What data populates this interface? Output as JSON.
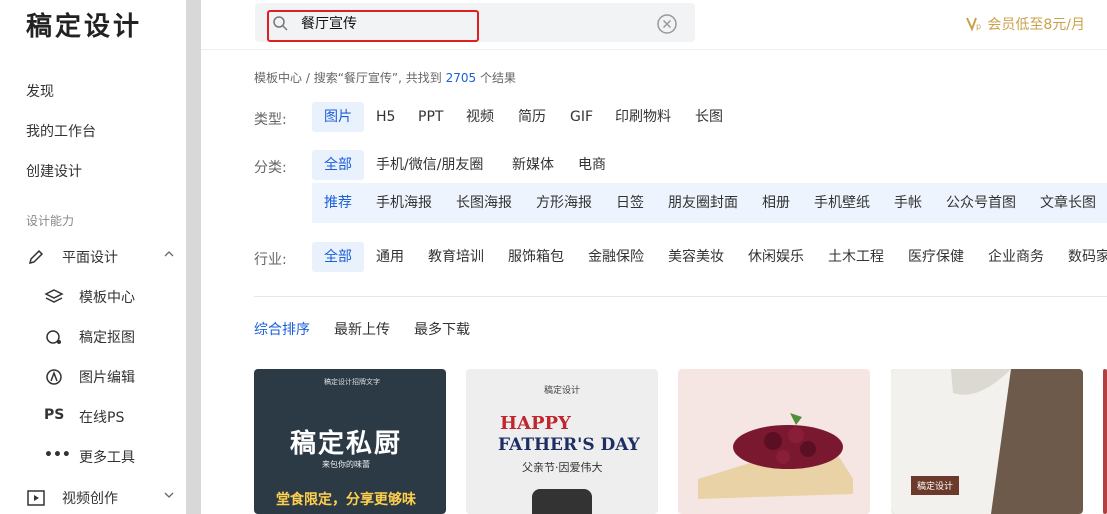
{
  "sidebar": {
    "logo": "稿定设计",
    "links": [
      "发现",
      "我的工作台",
      "创建设计"
    ],
    "section_title": "设计能力",
    "group1": "平面设计",
    "sub_items": [
      {
        "label": "模板中心",
        "icon": "layers-icon"
      },
      {
        "label": "稿定抠图",
        "icon": "cutout-icon"
      },
      {
        "label": "图片编辑",
        "icon": "image-edit-icon"
      },
      {
        "label": "在线PS",
        "icon": "ps-icon",
        "glyph": "PS"
      },
      {
        "label": "更多工具",
        "icon": "more-icon",
        "glyph": "•••"
      }
    ],
    "group2": "视频创作"
  },
  "search": {
    "value": "餐厅宣传",
    "placeholder": ""
  },
  "vip": {
    "text": "会员低至8元/月"
  },
  "breadcrumb": {
    "root": "模板中心",
    "sep": "/",
    "prefix": "搜索“餐厅宣传”, 共找到",
    "count": "2705",
    "suffix": "个结果"
  },
  "filters": {
    "type_label": "类型:",
    "types": [
      "图片",
      "H5",
      "PPT",
      "视频",
      "简历",
      "GIF",
      "印刷物料",
      "长图"
    ],
    "category_label": "分类:",
    "categories": [
      "全部",
      "手机/微信/朋友圈",
      "新媒体",
      "电商"
    ],
    "subcategories": [
      "推荐",
      "手机海报",
      "长图海报",
      "方形海报",
      "日签",
      "朋友圈封面",
      "相册",
      "手机壁纸",
      "手帐",
      "公众号首图",
      "文章长图"
    ],
    "industry_label": "行业:",
    "industries": [
      "全部",
      "通用",
      "教育培训",
      "服饰箱包",
      "金融保险",
      "美容美妆",
      "休闲娱乐",
      "土木工程",
      "医疗保健",
      "企业商务",
      "数码家"
    ]
  },
  "sort": [
    "综合排序",
    "最新上传",
    "最多下载"
  ],
  "cards": {
    "c1": {
      "small": "稿定设计招牌文字",
      "big": "稿定私厨",
      "sub": "来包你的味蕾",
      "foot": "堂食限定，分享更够味"
    },
    "c2": {
      "small": "稿定设计",
      "head": "HAPPY",
      "head2": "FATHER'S DAY",
      "sub": "父亲节·因爱伟大"
    },
    "c4": {
      "tag": "稿定设计"
    }
  },
  "colors": {
    "accent": "#1a5fd9",
    "chip_bg": "#e9f1fd",
    "vip": "#c9a24a",
    "highlight": "#e02020"
  }
}
